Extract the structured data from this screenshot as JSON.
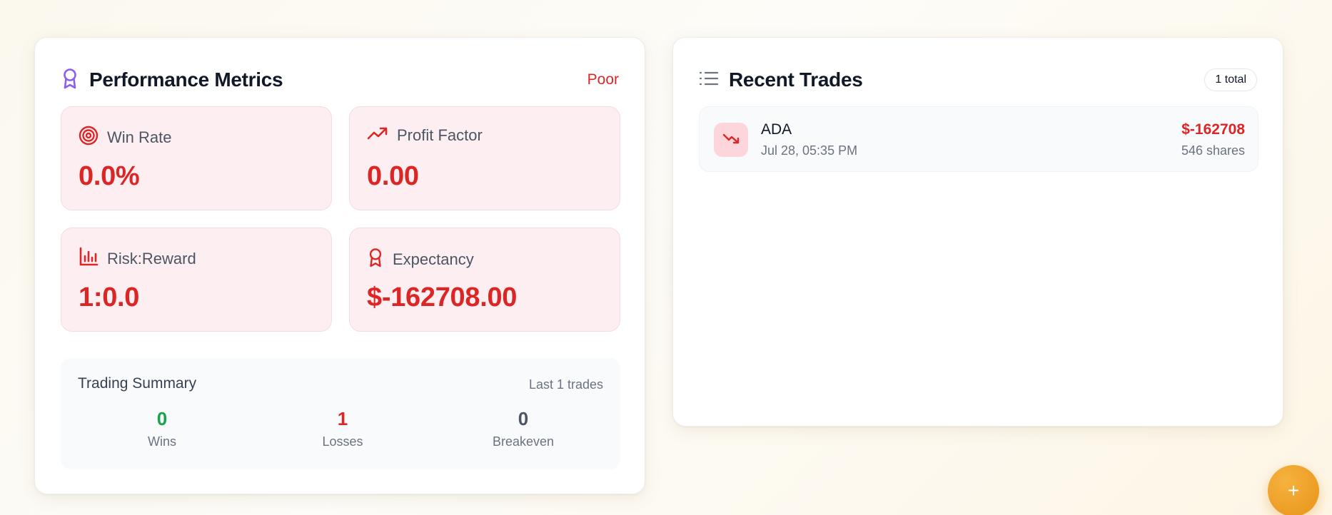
{
  "performance": {
    "title": "Performance Metrics",
    "rating": "Poor",
    "metrics": {
      "win_rate": {
        "label": "Win Rate",
        "value": "0.0%"
      },
      "profit_factor": {
        "label": "Profit Factor",
        "value": "0.00"
      },
      "risk_reward": {
        "label": "Risk:Reward",
        "value": "1:0.0"
      },
      "expectancy": {
        "label": "Expectancy",
        "value": "$-162708.00"
      }
    },
    "summary": {
      "title": "Trading Summary",
      "subtitle": "Last 1 trades",
      "wins": {
        "value": "0",
        "label": "Wins"
      },
      "losses": {
        "value": "1",
        "label": "Losses"
      },
      "breakeven": {
        "value": "0",
        "label": "Breakeven"
      }
    }
  },
  "recent_trades": {
    "title": "Recent Trades",
    "total_badge": "1 total",
    "trades": [
      {
        "symbol": "ADA",
        "datetime": "Jul 28, 05:35 PM",
        "pnl": "$-162708",
        "shares": "546 shares"
      }
    ]
  },
  "fab": {
    "label": "+"
  },
  "colors": {
    "negative": "#dc2626",
    "positive": "#16a34a",
    "neutral": "#4b5563",
    "accent_purple": "#8b5cf6",
    "fab": "#f0a32b"
  }
}
